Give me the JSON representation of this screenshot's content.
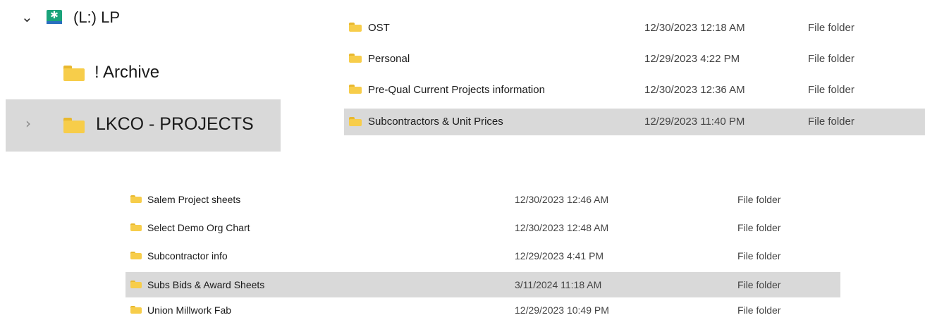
{
  "nav_tree": {
    "drive": {
      "label": "(L:) LP",
      "icon": "network-drive-icon",
      "expand_icon": "chevron-down-icon"
    },
    "items": [
      {
        "label": "! Archive",
        "icon": "folder-icon"
      },
      {
        "label": "LKCO - PROJECTS",
        "icon": "folder-icon",
        "expand_icon": "chevron-right-icon",
        "selected": true
      }
    ]
  },
  "file_list_top": {
    "rows": [
      {
        "name": "OST",
        "date": "12/30/2023 12:18 AM",
        "type": "File folder"
      },
      {
        "name": "Personal",
        "date": "12/29/2023 4:22 PM",
        "type": "File folder"
      },
      {
        "name": "Pre-Qual Current Projects information",
        "date": "12/30/2023 12:36 AM",
        "type": "File folder"
      },
      {
        "name": "Subcontractors & Unit Prices",
        "date": "12/29/2023 11:40 PM",
        "type": "File folder",
        "selected": true
      }
    ]
  },
  "file_list_bottom": {
    "rows": [
      {
        "name": "Salem Project sheets",
        "date": "12/30/2023 12:46 AM",
        "type": "File folder"
      },
      {
        "name": "Select Demo Org Chart",
        "date": "12/30/2023 12:48 AM",
        "type": "File folder"
      },
      {
        "name": "Subcontractor info",
        "date": "12/29/2023 4:41 PM",
        "type": "File folder"
      },
      {
        "name": "Subs Bids & Award Sheets",
        "date": "3/11/2024 11:18 AM",
        "type": "File folder",
        "selected": true
      },
      {
        "name": "Union Millwork Fab",
        "date": "12/29/2023 10:49 PM",
        "type": "File folder"
      }
    ]
  },
  "colors": {
    "selection": "#d9d9d9",
    "folder": "#f7cd4a",
    "folder_tab": "#e8b82e",
    "drive_icon": "#1aa37a"
  }
}
